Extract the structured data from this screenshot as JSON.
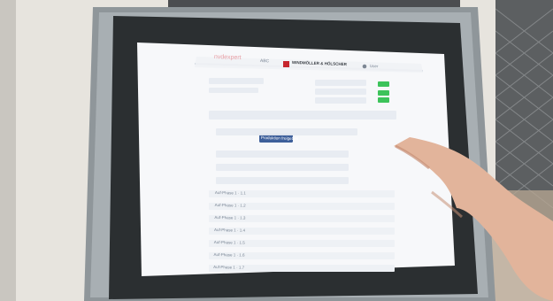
{
  "scene": {
    "description_colors": {
      "wall": "#e7e4de",
      "panel_frame": "#8f969a",
      "bezel": "#2b2f31",
      "screen": "#f7f8fa",
      "accent_green": "#3cc35a",
      "accent_blue": "#3d5f9a",
      "brand_red": "#c6262e",
      "skin": "#e2b49b"
    }
  },
  "screen_ui": {
    "header": {
      "app_name": "nvdexpert",
      "nav_item": "ABC",
      "brand_name": "WINDMÖLLER & HÖLSCHER",
      "user_label": "User"
    },
    "top_left_text": [
      "",
      ""
    ],
    "buttons": {
      "primary": "Produktion freigeben"
    },
    "list_rows": [
      "Auf-Phase 1 · 1.1",
      "Auf-Phase 1 · 1.2",
      "Auf-Phase 1 · 1.3",
      "Auf-Phase 1 · 1.4",
      "Auf-Phase 1 · 1.5",
      "Auf-Phase 1 · 1.6",
      "Auf-Phase 1 · 1.7"
    ]
  }
}
